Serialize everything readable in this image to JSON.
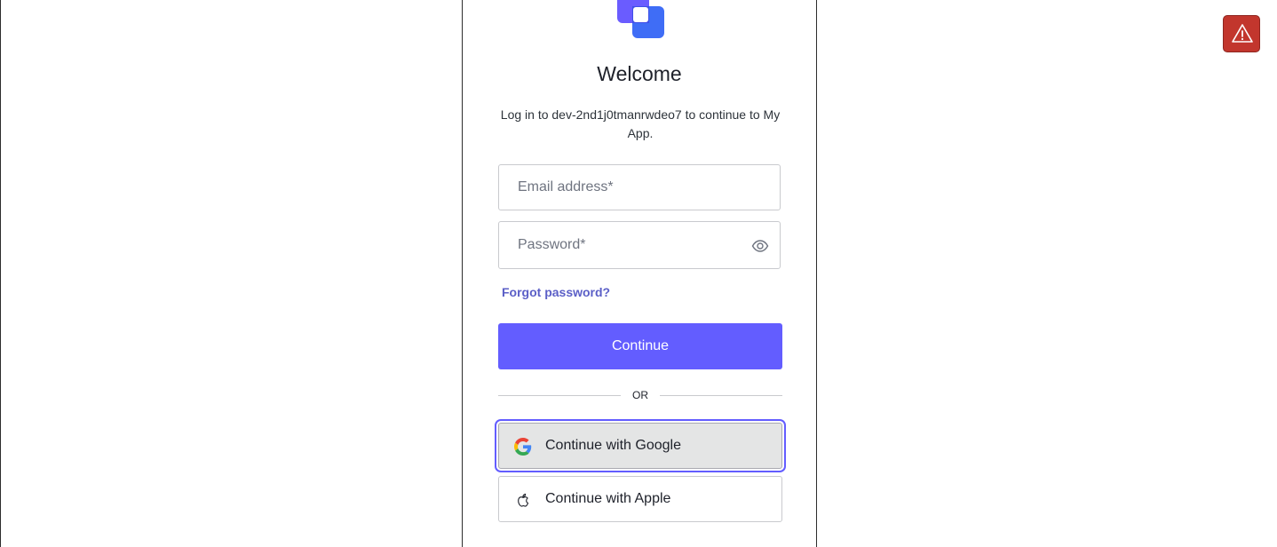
{
  "login": {
    "title": "Welcome",
    "subtitle": "Log in to dev-2nd1j0tmanrwdeo7 to continue to My App.",
    "email_placeholder": "Email address*",
    "password_placeholder": "Password*",
    "forgot_password": "Forgot password?",
    "continue_label": "Continue",
    "divider_label": "OR",
    "google_label": "Continue with Google",
    "apple_label": "Continue with Apple"
  },
  "icons": {
    "logo": "app-logo",
    "password_toggle": "eye-icon",
    "google": "google-icon",
    "apple": "apple-icon",
    "alert": "warning-icon"
  },
  "colors": {
    "primary": "#635dff",
    "link": "#5b5fc7",
    "alert": "#c2362d",
    "focus_ring": "#635dff"
  }
}
